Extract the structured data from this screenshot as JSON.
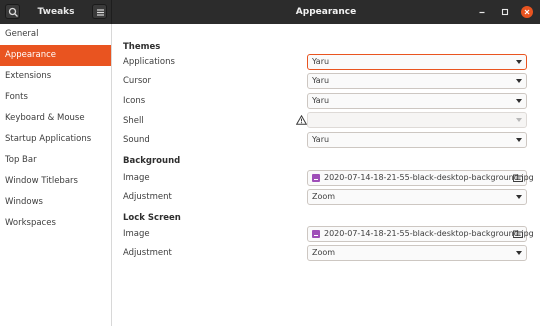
{
  "header": {
    "app_title": "Tweaks",
    "window_title": "Appearance"
  },
  "sidebar": {
    "items": [
      {
        "label": "General",
        "active": false
      },
      {
        "label": "Appearance",
        "active": true
      },
      {
        "label": "Extensions",
        "active": false
      },
      {
        "label": "Fonts",
        "active": false
      },
      {
        "label": "Keyboard & Mouse",
        "active": false
      },
      {
        "label": "Startup Applications",
        "active": false
      },
      {
        "label": "Top Bar",
        "active": false
      },
      {
        "label": "Window Titlebars",
        "active": false
      },
      {
        "label": "Windows",
        "active": false
      },
      {
        "label": "Workspaces",
        "active": false
      }
    ]
  },
  "themes": {
    "heading": "Themes",
    "applications_label": "Applications",
    "applications_value": "Yaru",
    "cursor_label": "Cursor",
    "cursor_value": "Yaru",
    "icons_label": "Icons",
    "icons_value": "Yaru",
    "shell_label": "Shell",
    "shell_value": "",
    "sound_label": "Sound",
    "sound_value": "Yaru"
  },
  "background": {
    "heading": "Background",
    "image_label": "Image",
    "image_value": "2020-07-14-18-21-55-black-desktop-background.jpg",
    "adjustment_label": "Adjustment",
    "adjustment_value": "Zoom"
  },
  "lock_screen": {
    "heading": "Lock Screen",
    "image_label": "Image",
    "image_value": "2020-07-14-18-21-55-black-desktop-background.jpg",
    "adjustment_label": "Adjustment",
    "adjustment_value": "Zoom"
  },
  "colors": {
    "accent": "#e95420",
    "header_bg": "#2c2c2c",
    "file_icon": "#9f4fb8"
  }
}
